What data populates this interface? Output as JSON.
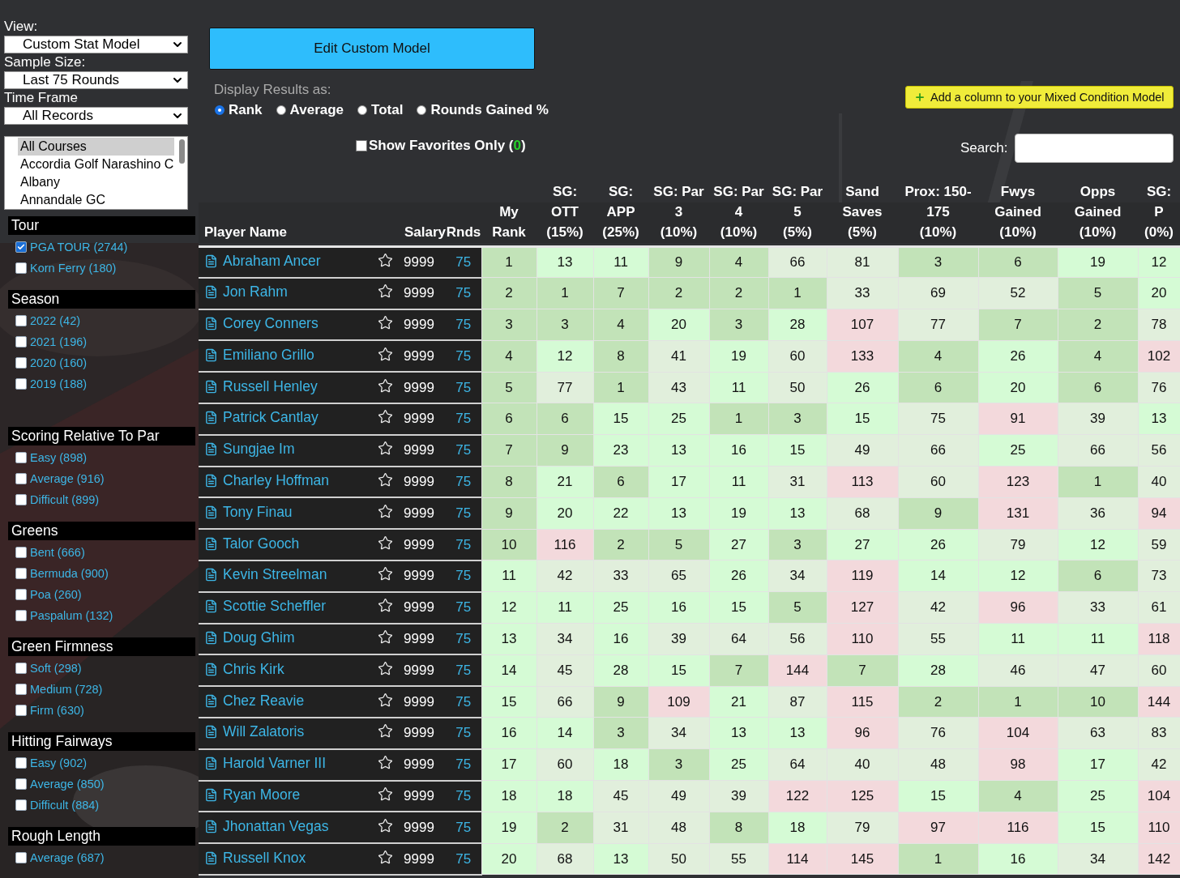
{
  "selects": [
    {
      "label": "View:",
      "value": "Custom Stat Model"
    },
    {
      "label": "Sample Size:",
      "value": "Last 75 Rounds"
    },
    {
      "label": "Time Frame",
      "value": "All Records"
    }
  ],
  "courses": [
    {
      "name": "All Courses",
      "selected": true
    },
    {
      "name": "Accordia Golf Narashino C",
      "selected": false
    },
    {
      "name": "Albany",
      "selected": false
    },
    {
      "name": "Annandale GC",
      "selected": false
    }
  ],
  "filter_groups": [
    {
      "title": "Tour",
      "items": [
        {
          "label": "PGA TOUR (2744)",
          "checked": true
        },
        {
          "label": "Korn Ferry (180)",
          "checked": false
        }
      ]
    },
    {
      "title": "Season",
      "items": [
        {
          "label": "2022 (42)",
          "checked": false
        },
        {
          "label": "2021 (196)",
          "checked": false
        },
        {
          "label": "2020 (160)",
          "checked": false
        },
        {
          "label": "2019 (188)",
          "checked": false
        }
      ]
    },
    {
      "title": "Scoring Relative To Par",
      "items": [
        {
          "label": "Easy (898)",
          "checked": false
        },
        {
          "label": "Average (916)",
          "checked": false
        },
        {
          "label": "Difficult (899)",
          "checked": false
        }
      ]
    },
    {
      "title": "Greens",
      "items": [
        {
          "label": "Bent (666)",
          "checked": false
        },
        {
          "label": "Bermuda (900)",
          "checked": false
        },
        {
          "label": "Poa (260)",
          "checked": false
        },
        {
          "label": "Paspalum (132)",
          "checked": false
        }
      ]
    },
    {
      "title": "Green Firmness",
      "items": [
        {
          "label": "Soft (298)",
          "checked": false
        },
        {
          "label": "Medium (728)",
          "checked": false
        },
        {
          "label": "Firm (630)",
          "checked": false
        }
      ]
    },
    {
      "title": "Hitting Fairways",
      "items": [
        {
          "label": "Easy (902)",
          "checked": false
        },
        {
          "label": "Average (850)",
          "checked": false
        },
        {
          "label": "Difficult (884)",
          "checked": false
        }
      ]
    },
    {
      "title": "Rough Length",
      "items": [
        {
          "label": "Average (687)",
          "checked": false
        }
      ]
    }
  ],
  "edit_button": "Edit Custom Model",
  "display_results": {
    "label": "Display Results as:",
    "options": [
      {
        "label": "Rank",
        "selected": true
      },
      {
        "label": "Average",
        "selected": false
      },
      {
        "label": "Total",
        "selected": false
      },
      {
        "label": "Rounds Gained %",
        "selected": false
      }
    ]
  },
  "add_column_button": "Add a column to your Mixed Condition Model",
  "favorites_filter": {
    "label_before": "Show Favorites Only (",
    "count": "0",
    "label_after": ")",
    "checked": false
  },
  "search": {
    "label": "Search:"
  },
  "table": {
    "player_headers": [
      "Player Name",
      "Salary",
      "Rnds"
    ],
    "columns": [
      "My\nRank",
      "SG:\nOTT\n(15%)",
      "SG:\nAPP\n(25%)",
      "SG: Par\n3\n(10%)",
      "SG: Par\n4\n(10%)",
      "SG: Par\n5\n(5%)",
      "Sand\nSaves\n(5%)",
      "Prox: 150-\n175\n(10%)",
      "Fwys\nGained\n(10%)",
      "Opps\nGained\n(10%)",
      "SG:\nP\n(0%)"
    ],
    "rows": [
      {
        "name": "Abraham Ancer",
        "favorite": false,
        "salary": "9999",
        "rounds": "75",
        "cells": [
          {
            "text": "1",
            "color": "#c2e3b8"
          },
          {
            "text": "13",
            "color": "#d5fbd5"
          },
          {
            "text": "11",
            "color": "#d5fbd5"
          },
          {
            "text": "9",
            "color": "#c2e3b8"
          },
          {
            "text": "4",
            "color": "#c2e3b8"
          },
          {
            "text": "66",
            "color": "#e1efdc"
          },
          {
            "text": "81",
            "color": "#e1efdc"
          },
          {
            "text": "3",
            "color": "#c2e3b8"
          },
          {
            "text": "6",
            "color": "#c2e3b8"
          },
          {
            "text": "19",
            "color": "#d5fbd5"
          },
          {
            "text": "12",
            "color": "#d5fbd5"
          }
        ]
      },
      {
        "name": "Jon Rahm",
        "favorite": false,
        "salary": "9999",
        "rounds": "75",
        "cells": [
          {
            "text": "2",
            "color": "#c2e3b8"
          },
          {
            "text": "1",
            "color": "#c2e3b8"
          },
          {
            "text": "7",
            "color": "#c2e3b8"
          },
          {
            "text": "2",
            "color": "#c2e3b8"
          },
          {
            "text": "2",
            "color": "#c2e3b8"
          },
          {
            "text": "1",
            "color": "#c2e3b8"
          },
          {
            "text": "33",
            "color": "#e1efdc"
          },
          {
            "text": "69",
            "color": "#e1efdc"
          },
          {
            "text": "52",
            "color": "#e1efdc"
          },
          {
            "text": "5",
            "color": "#c2e3b8"
          },
          {
            "text": "20",
            "color": "#d5fbd5"
          }
        ]
      },
      {
        "name": "Corey Conners",
        "favorite": false,
        "salary": "9999",
        "rounds": "75",
        "cells": [
          {
            "text": "3",
            "color": "#c2e3b8"
          },
          {
            "text": "3",
            "color": "#c2e3b8"
          },
          {
            "text": "4",
            "color": "#c2e3b8"
          },
          {
            "text": "20",
            "color": "#d5fbd5"
          },
          {
            "text": "3",
            "color": "#c2e3b8"
          },
          {
            "text": "28",
            "color": "#d5fbd5"
          },
          {
            "text": "107",
            "color": "#f3d9dc"
          },
          {
            "text": "77",
            "color": "#e1efdc"
          },
          {
            "text": "7",
            "color": "#c2e3b8"
          },
          {
            "text": "2",
            "color": "#c2e3b8"
          },
          {
            "text": "78",
            "color": "#e1efdc"
          }
        ]
      },
      {
        "name": "Emiliano Grillo",
        "favorite": false,
        "salary": "9999",
        "rounds": "75",
        "cells": [
          {
            "text": "4",
            "color": "#c2e3b8"
          },
          {
            "text": "12",
            "color": "#d5fbd5"
          },
          {
            "text": "8",
            "color": "#c2e3b8"
          },
          {
            "text": "41",
            "color": "#e1efdc"
          },
          {
            "text": "19",
            "color": "#d5fbd5"
          },
          {
            "text": "60",
            "color": "#e1efdc"
          },
          {
            "text": "133",
            "color": "#f3d9dc"
          },
          {
            "text": "4",
            "color": "#c2e3b8"
          },
          {
            "text": "26",
            "color": "#d5fbd5"
          },
          {
            "text": "4",
            "color": "#c2e3b8"
          },
          {
            "text": "102",
            "color": "#f3d9dc"
          }
        ]
      },
      {
        "name": "Russell Henley",
        "favorite": false,
        "salary": "9999",
        "rounds": "75",
        "cells": [
          {
            "text": "5",
            "color": "#c2e3b8"
          },
          {
            "text": "77",
            "color": "#e1efdc"
          },
          {
            "text": "1",
            "color": "#c2e3b8"
          },
          {
            "text": "43",
            "color": "#e1efdc"
          },
          {
            "text": "11",
            "color": "#d5fbd5"
          },
          {
            "text": "50",
            "color": "#e1efdc"
          },
          {
            "text": "26",
            "color": "#d5fbd5"
          },
          {
            "text": "6",
            "color": "#c2e3b8"
          },
          {
            "text": "20",
            "color": "#d5fbd5"
          },
          {
            "text": "6",
            "color": "#c2e3b8"
          },
          {
            "text": "76",
            "color": "#e1efdc"
          }
        ]
      },
      {
        "name": "Patrick Cantlay",
        "favorite": false,
        "salary": "9999",
        "rounds": "75",
        "cells": [
          {
            "text": "6",
            "color": "#c2e3b8"
          },
          {
            "text": "6",
            "color": "#c2e3b8"
          },
          {
            "text": "15",
            "color": "#d5fbd5"
          },
          {
            "text": "25",
            "color": "#d5fbd5"
          },
          {
            "text": "1",
            "color": "#c2e3b8"
          },
          {
            "text": "3",
            "color": "#c2e3b8"
          },
          {
            "text": "15",
            "color": "#d5fbd5"
          },
          {
            "text": "75",
            "color": "#e1efdc"
          },
          {
            "text": "91",
            "color": "#f3d9dc"
          },
          {
            "text": "39",
            "color": "#e1efdc"
          },
          {
            "text": "13",
            "color": "#d5fbd5"
          }
        ]
      },
      {
        "name": "Sungjae Im",
        "favorite": false,
        "salary": "9999",
        "rounds": "75",
        "cells": [
          {
            "text": "7",
            "color": "#c2e3b8"
          },
          {
            "text": "9",
            "color": "#c2e3b8"
          },
          {
            "text": "23",
            "color": "#d5fbd5"
          },
          {
            "text": "13",
            "color": "#d5fbd5"
          },
          {
            "text": "16",
            "color": "#d5fbd5"
          },
          {
            "text": "15",
            "color": "#d5fbd5"
          },
          {
            "text": "49",
            "color": "#e1efdc"
          },
          {
            "text": "66",
            "color": "#e1efdc"
          },
          {
            "text": "25",
            "color": "#d5fbd5"
          },
          {
            "text": "66",
            "color": "#e1efdc"
          },
          {
            "text": "56",
            "color": "#e1efdc"
          }
        ]
      },
      {
        "name": "Charley Hoffman",
        "favorite": false,
        "salary": "9999",
        "rounds": "75",
        "cells": [
          {
            "text": "8",
            "color": "#c2e3b8"
          },
          {
            "text": "21",
            "color": "#d5fbd5"
          },
          {
            "text": "6",
            "color": "#c2e3b8"
          },
          {
            "text": "17",
            "color": "#d5fbd5"
          },
          {
            "text": "11",
            "color": "#d5fbd5"
          },
          {
            "text": "31",
            "color": "#e1efdc"
          },
          {
            "text": "113",
            "color": "#f3d9dc"
          },
          {
            "text": "60",
            "color": "#e1efdc"
          },
          {
            "text": "123",
            "color": "#f3d9dc"
          },
          {
            "text": "1",
            "color": "#c2e3b8"
          },
          {
            "text": "40",
            "color": "#e1efdc"
          }
        ]
      },
      {
        "name": "Tony Finau",
        "favorite": false,
        "salary": "9999",
        "rounds": "75",
        "cells": [
          {
            "text": "9",
            "color": "#c2e3b8"
          },
          {
            "text": "20",
            "color": "#d5fbd5"
          },
          {
            "text": "22",
            "color": "#d5fbd5"
          },
          {
            "text": "13",
            "color": "#d5fbd5"
          },
          {
            "text": "19",
            "color": "#d5fbd5"
          },
          {
            "text": "13",
            "color": "#d5fbd5"
          },
          {
            "text": "68",
            "color": "#e1efdc"
          },
          {
            "text": "9",
            "color": "#c2e3b8"
          },
          {
            "text": "131",
            "color": "#f3d9dc"
          },
          {
            "text": "36",
            "color": "#e1efdc"
          },
          {
            "text": "94",
            "color": "#f3d9dc"
          }
        ]
      },
      {
        "name": "Talor Gooch",
        "favorite": false,
        "salary": "9999",
        "rounds": "75",
        "cells": [
          {
            "text": "10",
            "color": "#c2e3b8"
          },
          {
            "text": "116",
            "color": "#f3d9dc"
          },
          {
            "text": "2",
            "color": "#c2e3b8"
          },
          {
            "text": "5",
            "color": "#c2e3b8"
          },
          {
            "text": "27",
            "color": "#d5fbd5"
          },
          {
            "text": "3",
            "color": "#c2e3b8"
          },
          {
            "text": "27",
            "color": "#d5fbd5"
          },
          {
            "text": "26",
            "color": "#d5fbd5"
          },
          {
            "text": "79",
            "color": "#e1efdc"
          },
          {
            "text": "12",
            "color": "#d5fbd5"
          },
          {
            "text": "59",
            "color": "#e1efdc"
          }
        ]
      },
      {
        "name": "Kevin Streelman",
        "favorite": false,
        "salary": "9999",
        "rounds": "75",
        "cells": [
          {
            "text": "11",
            "color": "#d5fbd5"
          },
          {
            "text": "42",
            "color": "#e1efdc"
          },
          {
            "text": "33",
            "color": "#e1efdc"
          },
          {
            "text": "65",
            "color": "#e1efdc"
          },
          {
            "text": "26",
            "color": "#d5fbd5"
          },
          {
            "text": "34",
            "color": "#e1efdc"
          },
          {
            "text": "119",
            "color": "#f3d9dc"
          },
          {
            "text": "14",
            "color": "#d5fbd5"
          },
          {
            "text": "12",
            "color": "#d5fbd5"
          },
          {
            "text": "6",
            "color": "#c2e3b8"
          },
          {
            "text": "73",
            "color": "#e1efdc"
          }
        ]
      },
      {
        "name": "Scottie Scheffler",
        "favorite": false,
        "salary": "9999",
        "rounds": "75",
        "cells": [
          {
            "text": "12",
            "color": "#d5fbd5"
          },
          {
            "text": "11",
            "color": "#d5fbd5"
          },
          {
            "text": "25",
            "color": "#d5fbd5"
          },
          {
            "text": "16",
            "color": "#d5fbd5"
          },
          {
            "text": "15",
            "color": "#d5fbd5"
          },
          {
            "text": "5",
            "color": "#c2e3b8"
          },
          {
            "text": "127",
            "color": "#f3d9dc"
          },
          {
            "text": "42",
            "color": "#e1efdc"
          },
          {
            "text": "96",
            "color": "#f3d9dc"
          },
          {
            "text": "33",
            "color": "#e1efdc"
          },
          {
            "text": "61",
            "color": "#e1efdc"
          }
        ]
      },
      {
        "name": "Doug Ghim",
        "favorite": false,
        "salary": "9999",
        "rounds": "75",
        "cells": [
          {
            "text": "13",
            "color": "#d5fbd5"
          },
          {
            "text": "34",
            "color": "#e1efdc"
          },
          {
            "text": "16",
            "color": "#d5fbd5"
          },
          {
            "text": "39",
            "color": "#e1efdc"
          },
          {
            "text": "64",
            "color": "#e1efdc"
          },
          {
            "text": "56",
            "color": "#e1efdc"
          },
          {
            "text": "110",
            "color": "#f3d9dc"
          },
          {
            "text": "55",
            "color": "#e1efdc"
          },
          {
            "text": "11",
            "color": "#d5fbd5"
          },
          {
            "text": "11",
            "color": "#d5fbd5"
          },
          {
            "text": "118",
            "color": "#f3d9dc"
          }
        ]
      },
      {
        "name": "Chris Kirk",
        "favorite": false,
        "salary": "9999",
        "rounds": "75",
        "cells": [
          {
            "text": "14",
            "color": "#d5fbd5"
          },
          {
            "text": "45",
            "color": "#e1efdc"
          },
          {
            "text": "28",
            "color": "#d5fbd5"
          },
          {
            "text": "15",
            "color": "#d5fbd5"
          },
          {
            "text": "7",
            "color": "#c2e3b8"
          },
          {
            "text": "144",
            "color": "#f3d9dc"
          },
          {
            "text": "7",
            "color": "#c2e3b8"
          },
          {
            "text": "28",
            "color": "#d5fbd5"
          },
          {
            "text": "46",
            "color": "#e1efdc"
          },
          {
            "text": "47",
            "color": "#e1efdc"
          },
          {
            "text": "60",
            "color": "#e1efdc"
          }
        ]
      },
      {
        "name": "Chez Reavie",
        "favorite": false,
        "salary": "9999",
        "rounds": "75",
        "cells": [
          {
            "text": "15",
            "color": "#d5fbd5"
          },
          {
            "text": "66",
            "color": "#e1efdc"
          },
          {
            "text": "9",
            "color": "#c2e3b8"
          },
          {
            "text": "109",
            "color": "#f3d9dc"
          },
          {
            "text": "21",
            "color": "#d5fbd5"
          },
          {
            "text": "87",
            "color": "#e1efdc"
          },
          {
            "text": "115",
            "color": "#f3d9dc"
          },
          {
            "text": "2",
            "color": "#c2e3b8"
          },
          {
            "text": "1",
            "color": "#c2e3b8"
          },
          {
            "text": "10",
            "color": "#c2e3b8"
          },
          {
            "text": "144",
            "color": "#f3d9dc"
          }
        ]
      },
      {
        "name": "Will Zalatoris",
        "favorite": false,
        "salary": "9999",
        "rounds": "75",
        "cells": [
          {
            "text": "16",
            "color": "#d5fbd5"
          },
          {
            "text": "14",
            "color": "#d5fbd5"
          },
          {
            "text": "3",
            "color": "#c2e3b8"
          },
          {
            "text": "34",
            "color": "#e1efdc"
          },
          {
            "text": "13",
            "color": "#d5fbd5"
          },
          {
            "text": "13",
            "color": "#d5fbd5"
          },
          {
            "text": "96",
            "color": "#f3d9dc"
          },
          {
            "text": "76",
            "color": "#e1efdc"
          },
          {
            "text": "104",
            "color": "#f3d9dc"
          },
          {
            "text": "63",
            "color": "#e1efdc"
          },
          {
            "text": "83",
            "color": "#e1efdc"
          }
        ]
      },
      {
        "name": "Harold Varner III",
        "favorite": false,
        "salary": "9999",
        "rounds": "75",
        "cells": [
          {
            "text": "17",
            "color": "#d5fbd5"
          },
          {
            "text": "60",
            "color": "#e1efdc"
          },
          {
            "text": "18",
            "color": "#d5fbd5"
          },
          {
            "text": "3",
            "color": "#c2e3b8"
          },
          {
            "text": "25",
            "color": "#d5fbd5"
          },
          {
            "text": "64",
            "color": "#e1efdc"
          },
          {
            "text": "40",
            "color": "#e1efdc"
          },
          {
            "text": "48",
            "color": "#e1efdc"
          },
          {
            "text": "98",
            "color": "#f3d9dc"
          },
          {
            "text": "17",
            "color": "#d5fbd5"
          },
          {
            "text": "42",
            "color": "#e1efdc"
          }
        ]
      },
      {
        "name": "Ryan Moore",
        "favorite": false,
        "salary": "9999",
        "rounds": "75",
        "cells": [
          {
            "text": "18",
            "color": "#d5fbd5"
          },
          {
            "text": "18",
            "color": "#d5fbd5"
          },
          {
            "text": "45",
            "color": "#e1efdc"
          },
          {
            "text": "49",
            "color": "#e1efdc"
          },
          {
            "text": "39",
            "color": "#e1efdc"
          },
          {
            "text": "122",
            "color": "#f3d9dc"
          },
          {
            "text": "125",
            "color": "#f3d9dc"
          },
          {
            "text": "15",
            "color": "#d5fbd5"
          },
          {
            "text": "4",
            "color": "#c2e3b8"
          },
          {
            "text": "25",
            "color": "#d5fbd5"
          },
          {
            "text": "104",
            "color": "#f3d9dc"
          }
        ]
      },
      {
        "name": "Jhonattan Vegas",
        "favorite": false,
        "salary": "9999",
        "rounds": "75",
        "cells": [
          {
            "text": "19",
            "color": "#d5fbd5"
          },
          {
            "text": "2",
            "color": "#c2e3b8"
          },
          {
            "text": "31",
            "color": "#e1efdc"
          },
          {
            "text": "48",
            "color": "#e1efdc"
          },
          {
            "text": "8",
            "color": "#c2e3b8"
          },
          {
            "text": "18",
            "color": "#d5fbd5"
          },
          {
            "text": "79",
            "color": "#e1efdc"
          },
          {
            "text": "97",
            "color": "#f3d9dc"
          },
          {
            "text": "116",
            "color": "#f3d9dc"
          },
          {
            "text": "15",
            "color": "#d5fbd5"
          },
          {
            "text": "110",
            "color": "#f3d9dc"
          }
        ]
      },
      {
        "name": "Russell Knox",
        "favorite": false,
        "salary": "9999",
        "rounds": "75",
        "cells": [
          {
            "text": "20",
            "color": "#d5fbd5"
          },
          {
            "text": "68",
            "color": "#e1efdc"
          },
          {
            "text": "13",
            "color": "#d5fbd5"
          },
          {
            "text": "50",
            "color": "#e1efdc"
          },
          {
            "text": "55",
            "color": "#e1efdc"
          },
          {
            "text": "114",
            "color": "#f3d9dc"
          },
          {
            "text": "145",
            "color": "#f3d9dc"
          },
          {
            "text": "1",
            "color": "#c2e3b8"
          },
          {
            "text": "16",
            "color": "#d5fbd5"
          },
          {
            "text": "34",
            "color": "#e1efdc"
          },
          {
            "text": "142",
            "color": "#f3d9dc"
          }
        ]
      }
    ]
  }
}
